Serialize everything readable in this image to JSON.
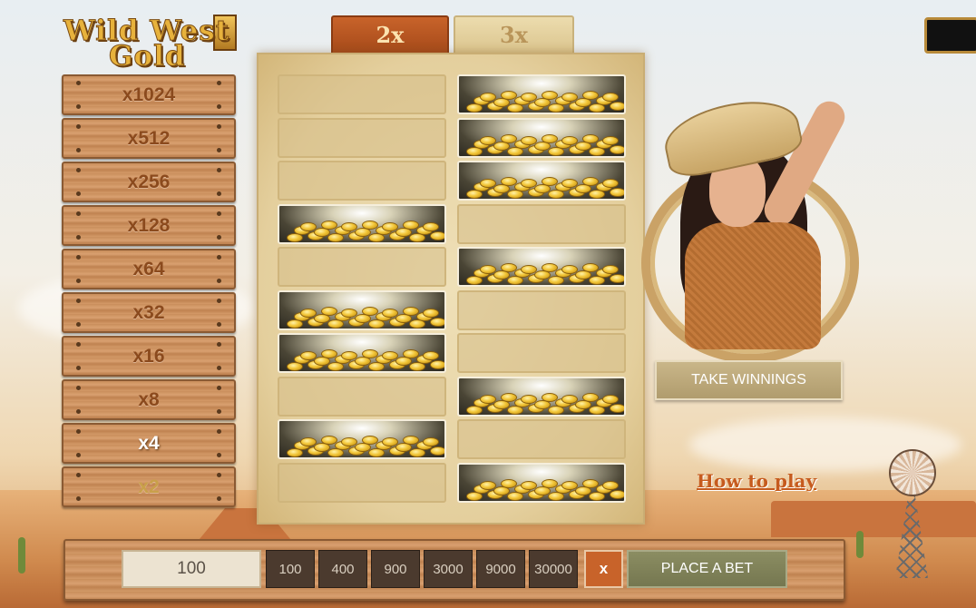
{
  "logo": {
    "line1": "Wild West",
    "line2": "Gold"
  },
  "multipliers": [
    {
      "label": "x1024",
      "state": "normal"
    },
    {
      "label": "x512",
      "state": "normal"
    },
    {
      "label": "x256",
      "state": "normal"
    },
    {
      "label": "x128",
      "state": "normal"
    },
    {
      "label": "x64",
      "state": "normal"
    },
    {
      "label": "x32",
      "state": "normal"
    },
    {
      "label": "x16",
      "state": "normal"
    },
    {
      "label": "x8",
      "state": "normal"
    },
    {
      "label": "x4",
      "state": "active"
    },
    {
      "label": "x2",
      "state": "dim"
    }
  ],
  "tabs": [
    {
      "label": "2x",
      "selected": true
    },
    {
      "label": "3x",
      "selected": false
    }
  ],
  "board": {
    "columns": 2,
    "rows": [
      [
        "empty",
        "gold"
      ],
      [
        "empty",
        "gold"
      ],
      [
        "empty",
        "gold"
      ],
      [
        "gold",
        "empty"
      ],
      [
        "empty",
        "gold"
      ],
      [
        "gold",
        "empty"
      ],
      [
        "gold",
        "empty"
      ],
      [
        "empty",
        "gold"
      ],
      [
        "gold",
        "empty"
      ],
      [
        "empty",
        "gold"
      ]
    ]
  },
  "take_winnings_label": "TAKE WINNINGS",
  "how_to_play_label": "How to play",
  "bet": {
    "amount": "100",
    "chips": [
      "100",
      "400",
      "900",
      "3000",
      "9000",
      "30000"
    ],
    "clear_label": "x",
    "place_label": "PLACE A BET"
  },
  "colors": {
    "accent_orange": "#c8632a",
    "place_button": "#8b8d62",
    "chip_bg": "#4b3a2e"
  }
}
